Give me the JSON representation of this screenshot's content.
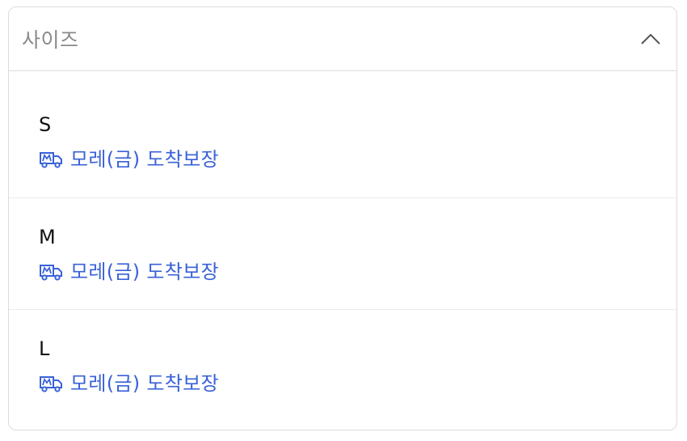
{
  "dropdown": {
    "label": "사이즈",
    "chevron_icon": "chevron-up-icon",
    "expanded": true
  },
  "options": [
    {
      "name": "S",
      "delivery_icon": "delivery-truck-icon",
      "delivery_text": "모레(금) 도착보장"
    },
    {
      "name": "M",
      "delivery_icon": "delivery-truck-icon",
      "delivery_text": "모레(금) 도착보장"
    },
    {
      "name": "L",
      "delivery_icon": "delivery-truck-icon",
      "delivery_text": "모레(금) 도착보장"
    }
  ],
  "colors": {
    "delivery_accent": "#3a62d8",
    "label_gray": "#8a8a8a",
    "border": "#dcdcdc"
  }
}
